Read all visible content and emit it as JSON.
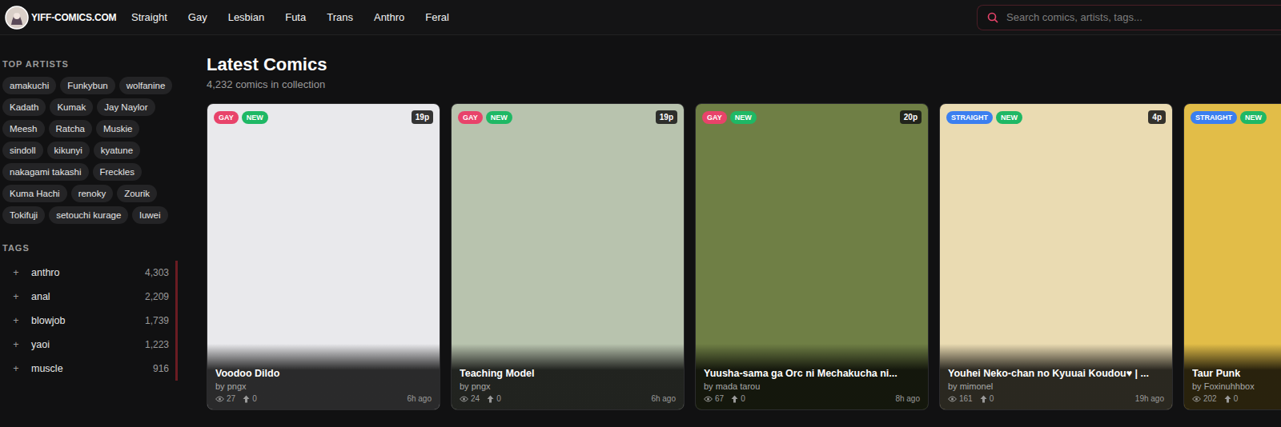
{
  "header": {
    "logo": "YIFF-COMICS.COM",
    "nav": [
      "Straight",
      "Gay",
      "Lesbian",
      "Futa",
      "Trans",
      "Anthro",
      "Feral"
    ],
    "search": {
      "placeholder": "Search comics, artists, tags..."
    }
  },
  "sidebar": {
    "artists_title": "TOP ARTISTS",
    "artists": [
      "amakuchi",
      "Funkybun",
      "wolfanine",
      "Kadath",
      "Kumak",
      "Jay Naylor",
      "Meesh",
      "Ratcha",
      "Muskie",
      "sindoll",
      "kikunyi",
      "kyatune",
      "nakagami takashi",
      "Freckles",
      "Kuma Hachi",
      "renoky",
      "Zourik",
      "Tokifuji",
      "setouchi kurage",
      "luwei"
    ],
    "tags_title": "TAGS",
    "tags": [
      {
        "icon": "+",
        "name": "anthro",
        "count": "4,303"
      },
      {
        "icon": "+",
        "name": "anal",
        "count": "2,209"
      },
      {
        "icon": "+",
        "name": "blowjob",
        "count": "1,739"
      },
      {
        "icon": "+",
        "name": "yaoi",
        "count": "1,223"
      },
      {
        "icon": "+",
        "name": "muscle",
        "count": "916"
      }
    ]
  },
  "main": {
    "title": "Latest Comics",
    "subtitle": "4,232 comics in collection",
    "cards": [
      {
        "badges": [
          {
            "label": "GAY",
            "color": "#e8436a"
          },
          {
            "label": "NEW",
            "color": "#1fb865"
          }
        ],
        "pages": "19p",
        "title": "Voodoo Dildo",
        "author": "by pngx",
        "views": "27",
        "votes": "0",
        "time": "6h ago"
      },
      {
        "badges": [
          {
            "label": "GAY",
            "color": "#e8436a"
          },
          {
            "label": "NEW",
            "color": "#1fb865"
          }
        ],
        "pages": "19p",
        "title": "Teaching Model",
        "author": "by pngx",
        "views": "24",
        "votes": "0",
        "time": "6h ago"
      },
      {
        "badges": [
          {
            "label": "GAY",
            "color": "#e8436a"
          },
          {
            "label": "NEW",
            "color": "#1fb865"
          }
        ],
        "pages": "20p",
        "title": "Yuusha-sama ga Orc ni Mechakucha ni...",
        "author": "by mada tarou",
        "views": "67",
        "votes": "0",
        "time": "8h ago"
      },
      {
        "badges": [
          {
            "label": "STRAIGHT",
            "color": "#3b7ff0"
          },
          {
            "label": "NEW",
            "color": "#1fb865"
          }
        ],
        "pages": "4p",
        "title": "Youhei Neko-chan no Kyuuai Koudou♥ | ...",
        "author": "by mimonel",
        "views": "161",
        "votes": "0",
        "time": "19h ago"
      },
      {
        "badges": [
          {
            "label": "STRAIGHT",
            "color": "#3b7ff0"
          },
          {
            "label": "NEW",
            "color": "#1fb865"
          }
        ],
        "pages": "",
        "title": "Taur Punk",
        "author": "by Foxinuhhbox",
        "views": "202",
        "votes": "0",
        "time": ""
      }
    ]
  }
}
